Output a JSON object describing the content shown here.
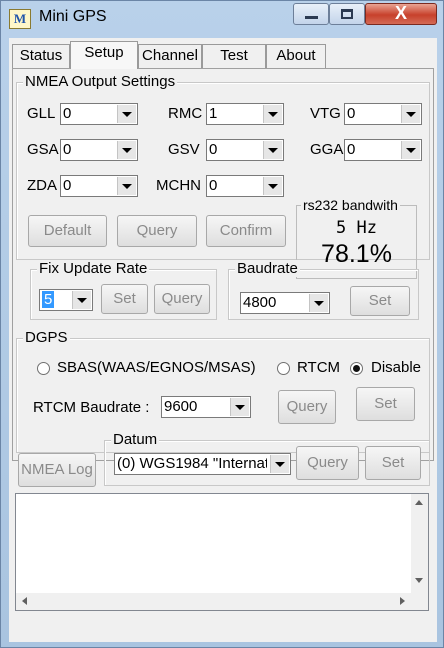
{
  "window": {
    "title": "Mini GPS",
    "icon_letter": "M",
    "close_glyph": "X"
  },
  "tabs": [
    {
      "label": "Status"
    },
    {
      "label": "Setup"
    },
    {
      "label": "Channel"
    },
    {
      "label": "Test"
    },
    {
      "label": "About"
    }
  ],
  "nmea": {
    "group_label": "NMEA Output Settings",
    "fields": [
      {
        "label": "GLL",
        "value": "0"
      },
      {
        "label": "RMC",
        "value": "1"
      },
      {
        "label": "VTG",
        "value": "0"
      },
      {
        "label": "GSA",
        "value": "0"
      },
      {
        "label": "GSV",
        "value": "0"
      },
      {
        "label": "GGA",
        "value": "0"
      },
      {
        "label": "ZDA",
        "value": "0"
      },
      {
        "label": "MCHN",
        "value": "0"
      }
    ],
    "buttons": {
      "default": "Default",
      "query": "Query",
      "confirm": "Confirm"
    }
  },
  "rs232": {
    "title": "rs232 bandwith",
    "rate": "5  Hz",
    "percent": "78.1%"
  },
  "fix_rate": {
    "group_label": "Fix Update Rate",
    "value": "5",
    "set": "Set",
    "query": "Query"
  },
  "baudrate": {
    "group_label": "Baudrate",
    "value": "4800",
    "set": "Set"
  },
  "dgps": {
    "group_label": "DGPS",
    "radio_sbas": "SBAS(WAAS/EGNOS/MSAS)",
    "radio_rtcm": "RTCM",
    "radio_disable": "Disable",
    "selected": "Disable",
    "rtcm_label": "RTCM Baudrate :",
    "rtcm_value": "9600",
    "query": "Query",
    "set": "Set"
  },
  "nmea_log": "NMEA Log",
  "datum": {
    "group_label": "Datum",
    "value": "(0) WGS1984 \"Internati",
    "query": "Query",
    "set": "Set"
  },
  "colors": {
    "titlebar": "#b9d1ea",
    "close": "#c7412b",
    "face": "#f0f0f0",
    "disabled_text": "#8a8a8a"
  }
}
